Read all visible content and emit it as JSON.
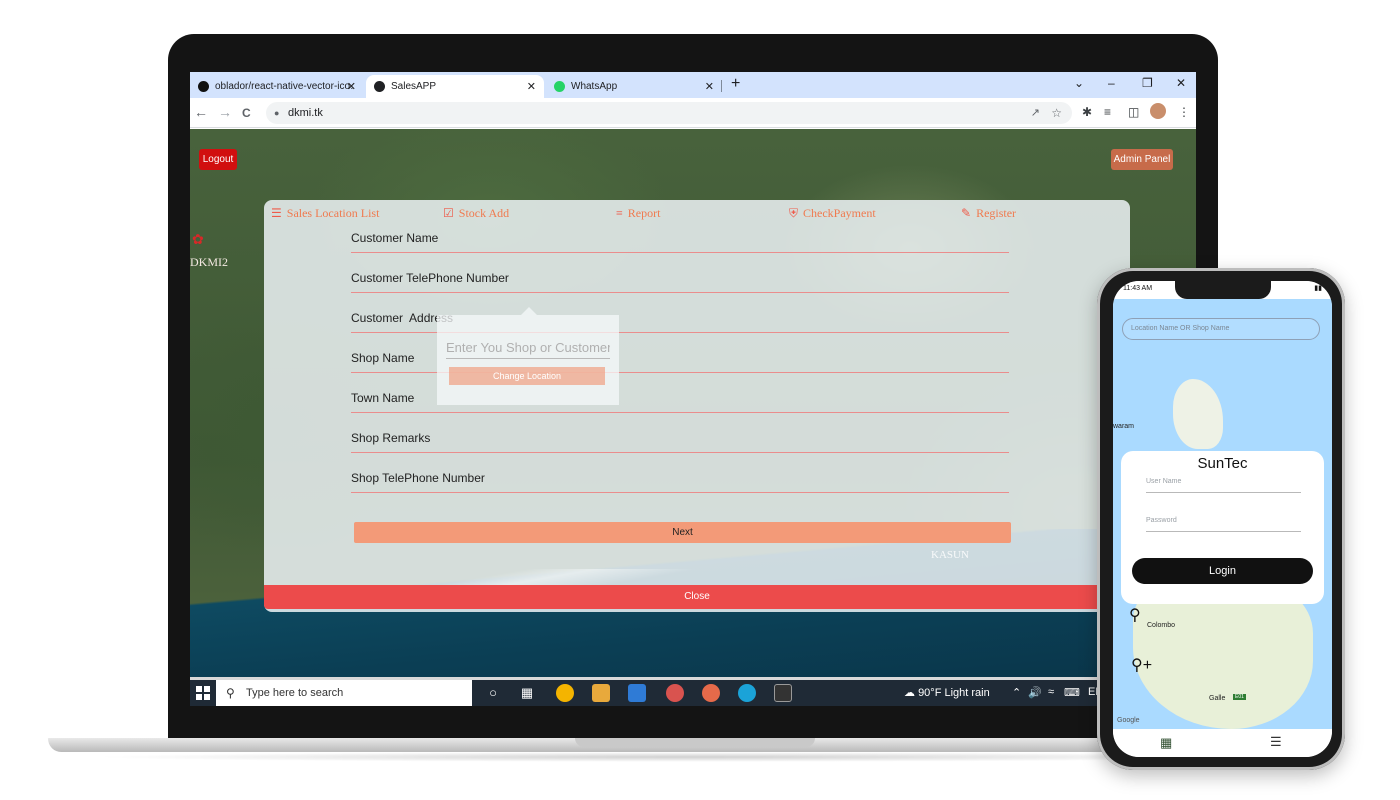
{
  "browser": {
    "tabs": [
      {
        "label": "oblador/react-native-vector-ico…",
        "close": "✕"
      },
      {
        "label": "SalesAPP",
        "close": "✕"
      },
      {
        "label": "WhatsApp",
        "close": "✕"
      }
    ],
    "new_tab": "+",
    "window_controls": {
      "minimize": "–",
      "restore": "❐",
      "close": "✕",
      "dropdown": "⌄"
    },
    "url": "dkmi.tk",
    "nav": {
      "back": "←",
      "forward": "→",
      "reload": "C"
    }
  },
  "page": {
    "logout_label": "Logout",
    "admin_label": "Admin Panel",
    "side_label": "DKMI2",
    "menu": [
      {
        "label": "Sales Location List",
        "icon": "list-icon"
      },
      {
        "label": "Stock Add",
        "icon": "calendar-check-icon"
      },
      {
        "label": "Report",
        "icon": "list-bullets-icon"
      },
      {
        "label": "CheckPayment",
        "icon": "shield-check-icon"
      },
      {
        "label": "Register",
        "icon": "note-plus-icon"
      }
    ],
    "fields": [
      "Customer Name",
      "Customer TelePhone Number",
      "Customer  Address",
      "Shop Name",
      "Town Name",
      "Shop Remarks",
      "Shop TelePhone Number"
    ],
    "popup": {
      "placeholder": "Enter You Shop or Customer",
      "button_label": "Change Location"
    },
    "next_label": "Next",
    "watermark": "KASUN",
    "close_label": "Close"
  },
  "taskbar": {
    "search_placeholder": "Type here to search",
    "weather": "90°F  Light rain",
    "lang": "EN"
  },
  "phone": {
    "time": "11:43 AM",
    "search_placeholder": "Location Name OR Shop Name",
    "title": "SunTec",
    "username_placeholder": "User Name",
    "password_placeholder": "Password",
    "login_label": "Login",
    "map_labels": {
      "colombo": "Colombo",
      "galle": "Galle",
      "waram": "waram",
      "google": "Google",
      "road": "E01"
    }
  },
  "colors": {
    "accent": "#f07a4f",
    "logout": "#d10f0f",
    "admin": "#c76b4a",
    "close": "#ec4b4b",
    "next": "#f39a78"
  }
}
